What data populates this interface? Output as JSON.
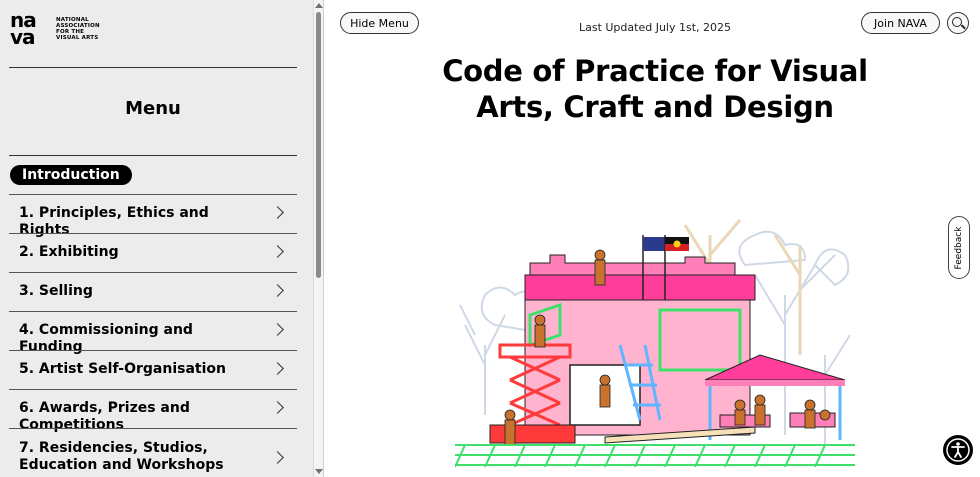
{
  "logo": {
    "mark_line1": "na",
    "mark_line2": "va",
    "text_lines": [
      "NATIONAL",
      "ASSOCIATION",
      "FOR THE",
      "VISUAL ARTS"
    ]
  },
  "sidebar": {
    "menu_title": "Menu",
    "active_item": "Introduction",
    "items": [
      {
        "label": "1. Principles, Ethics and Rights"
      },
      {
        "label": "2. Exhibiting"
      },
      {
        "label": "3. Selling"
      },
      {
        "label": "4. Commissioning and Funding"
      },
      {
        "label": "5. Artist Self-Organisation"
      },
      {
        "label": "6. Awards, Prizes and Competitions"
      },
      {
        "label": "7. Residencies, Studios, Education and Workshops"
      }
    ]
  },
  "header": {
    "hide_menu_label": "Hide Menu",
    "last_updated": "Last Updated July 1st, 2025",
    "join_label": "Join NAVA"
  },
  "main": {
    "title": "Code of Practice for Visual Arts, Craft and Design"
  },
  "feedback_label": "Feedback",
  "colors": {
    "accent_pink": "#ff3d9a",
    "sidebar_bg": "#ececec"
  },
  "icons": {
    "search": "search-icon",
    "chevron": "chevron-right-icon",
    "accessibility": "accessibility-icon"
  }
}
